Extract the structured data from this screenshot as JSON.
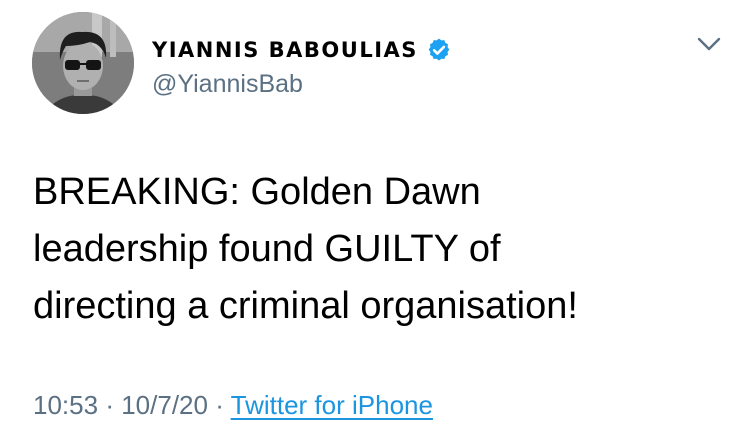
{
  "user": {
    "display_name": "YIANNIS BABOULIAS",
    "handle": "@YiannisBab",
    "verified": true,
    "avatar_icon": "profile-photo"
  },
  "tweet": {
    "lines": [
      "BREAKING: Golden Dawn",
      "leadership found GUILTY of",
      "directing a criminal organisation!"
    ]
  },
  "meta": {
    "time": "10:53",
    "separator": "·",
    "date": "10/7/20",
    "source": "Twitter for iPhone"
  },
  "colors": {
    "verified_badge": "#1da1f2",
    "secondary_text": "#5b7083",
    "link": "#1b95e0"
  },
  "icons": {
    "more": "chevron-down-icon",
    "verified": "verified-badge-icon"
  }
}
